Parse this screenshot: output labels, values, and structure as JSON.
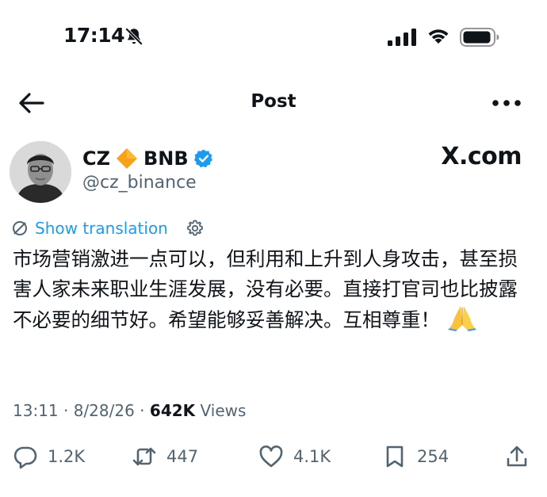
{
  "status_bar": {
    "time": "17:14"
  },
  "nav": {
    "title": "Post"
  },
  "author": {
    "display_name": "CZ",
    "name_suffix": "BNB",
    "handle": "@cz_binance",
    "source_label": "X.com"
  },
  "translation": {
    "label": "Show translation"
  },
  "tweet": {
    "text": "市场营销激进一点可以，但利用和上升到人身攻击，甚至损害人家未来职业生涯发展，没有必要。直接打官司也比披露不必要的细节好。希望能够妥善解决。互相尊重！"
  },
  "meta": {
    "time": "13:11",
    "separator1": " · ",
    "date": "8/28/26",
    "separator2": " · ",
    "views_count": "642K",
    "views_label": " Views"
  },
  "actions": {
    "replies": "1.2K",
    "reposts": "447",
    "likes": "4.1K",
    "bookmarks": "254"
  },
  "colors": {
    "accent": "#1d9bf0",
    "muted": "#536471",
    "text": "#0f1419",
    "bnb_orange": "#f7a21b"
  },
  "icons": [
    "bell-off-icon",
    "signal-icon",
    "wifi-icon",
    "battery-icon",
    "back-arrow-icon",
    "more-icon",
    "diamond-icon",
    "verified-icon",
    "translate-icon",
    "gear-icon",
    "pray-emoji",
    "reply-icon",
    "retweet-icon",
    "like-icon",
    "bookmark-icon",
    "share-icon"
  ]
}
